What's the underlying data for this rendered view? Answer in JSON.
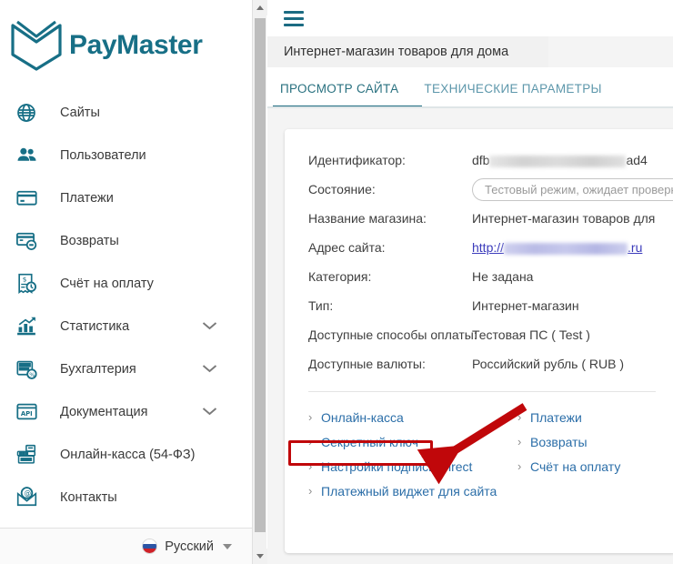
{
  "brand": {
    "name": "PayMaster",
    "accent": "#176f86"
  },
  "sidebar": {
    "items": [
      {
        "icon": "globe-icon",
        "label": "Сайты",
        "expandable": false
      },
      {
        "icon": "users-icon",
        "label": "Пользователи",
        "expandable": false
      },
      {
        "icon": "credit-card-icon",
        "label": "Платежи",
        "expandable": false
      },
      {
        "icon": "refund-card-icon",
        "label": "Возвраты",
        "expandable": false
      },
      {
        "icon": "invoice-icon",
        "label": "Счёт на оплату",
        "expandable": false
      },
      {
        "icon": "bar-chart-icon",
        "label": "Статистика",
        "expandable": true
      },
      {
        "icon": "accounting-icon",
        "label": "Бухгалтерия",
        "expandable": true
      },
      {
        "icon": "api-doc-icon",
        "label": "Документация",
        "expandable": true
      },
      {
        "icon": "cash-register-icon",
        "label": "Онлайн-касса (54-ФЗ)",
        "expandable": false
      },
      {
        "icon": "mail-at-icon",
        "label": "Контакты",
        "expandable": false
      }
    ],
    "language": {
      "label": "Русский",
      "flag": "russia-flag-icon"
    }
  },
  "topbar": {
    "menu_icon": "hamburger-menu-icon"
  },
  "breadcrumb": {
    "text": "Интернет-магазин товаров для дома"
  },
  "tabs": [
    {
      "label": "ПРОСМОТР САЙТА",
      "active": true
    },
    {
      "label": "ТЕХНИЧЕСКИЕ ПАРАМЕТРЫ",
      "active": false
    },
    {
      "label": "",
      "active": false
    }
  ],
  "details": [
    {
      "label": "Идентификатор:",
      "value_prefix": "dfb",
      "redacted": true,
      "value_suffix": "ad4",
      "redact_width": 150
    },
    {
      "label": "Состояние:",
      "badge": "Тестовый режим, ожидает проверки"
    },
    {
      "label": "Название магазина:",
      "value": "Интернет-магазин товаров для"
    },
    {
      "label": "Адрес сайта:",
      "link_prefix": "http://",
      "redacted_url": true,
      "link_suffix": ".ru",
      "redact_width": 136
    },
    {
      "label": "Категория:",
      "value": "Не задана"
    },
    {
      "label": "Тип:",
      "value": "Интернет-магазин"
    },
    {
      "label": "Доступные способы оплаты:",
      "value": "Тестовая ПС ( Test )"
    },
    {
      "label": "Доступные валюты:",
      "value": "Российский рубль ( RUB )"
    }
  ],
  "action_links": {
    "left": [
      {
        "label": "Онлайн-касса",
        "highlighted": false
      },
      {
        "label": "Секретный ключ",
        "highlighted": true
      },
      {
        "label": "Настройки подписи Direct",
        "highlighted": false
      },
      {
        "label": "Платежный виджет для сайта",
        "highlighted": false
      }
    ],
    "right": [
      {
        "label": "Платежи"
      },
      {
        "label": "Возвраты"
      },
      {
        "label": "Счёт на оплату"
      }
    ]
  },
  "annotation": {
    "highlight_color": "#c0070a",
    "arrow_color": "#c0070a",
    "target": "Секретный ключ"
  }
}
